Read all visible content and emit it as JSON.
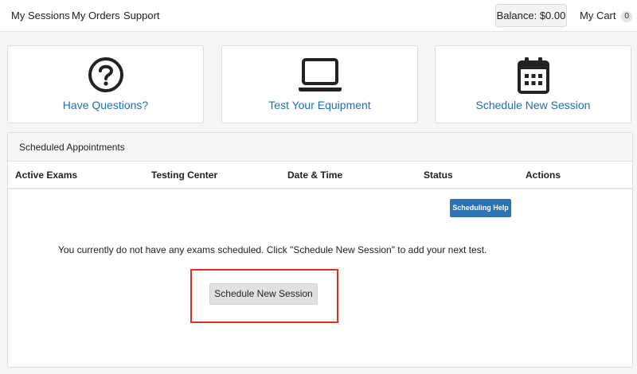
{
  "nav": {
    "links": [
      "My Sessions",
      "My Orders",
      "Support"
    ],
    "balance": "Balance: $0.00",
    "cart_label": "My Cart",
    "cart_count": "0"
  },
  "cards": [
    {
      "label": "Have Questions?",
      "icon": "question-circle-icon"
    },
    {
      "label": "Test Your Equipment",
      "icon": "laptop-icon"
    },
    {
      "label": "Schedule New Session",
      "icon": "calendar-icon"
    }
  ],
  "panel": {
    "title": "Scheduled Appointments",
    "columns": [
      "Active Exams",
      "Testing Center",
      "Date & Time",
      "Status",
      "Actions"
    ],
    "help_button": "Scheduling Help",
    "empty_message": "You currently do not have any exams scheduled. Click \"Schedule New Session\" to add your next test.",
    "schedule_button": "Schedule New Session"
  },
  "colors": {
    "link_blue": "#1e6fb1",
    "button_blue": "#2b73b5",
    "highlight_red": "#d9301f"
  }
}
